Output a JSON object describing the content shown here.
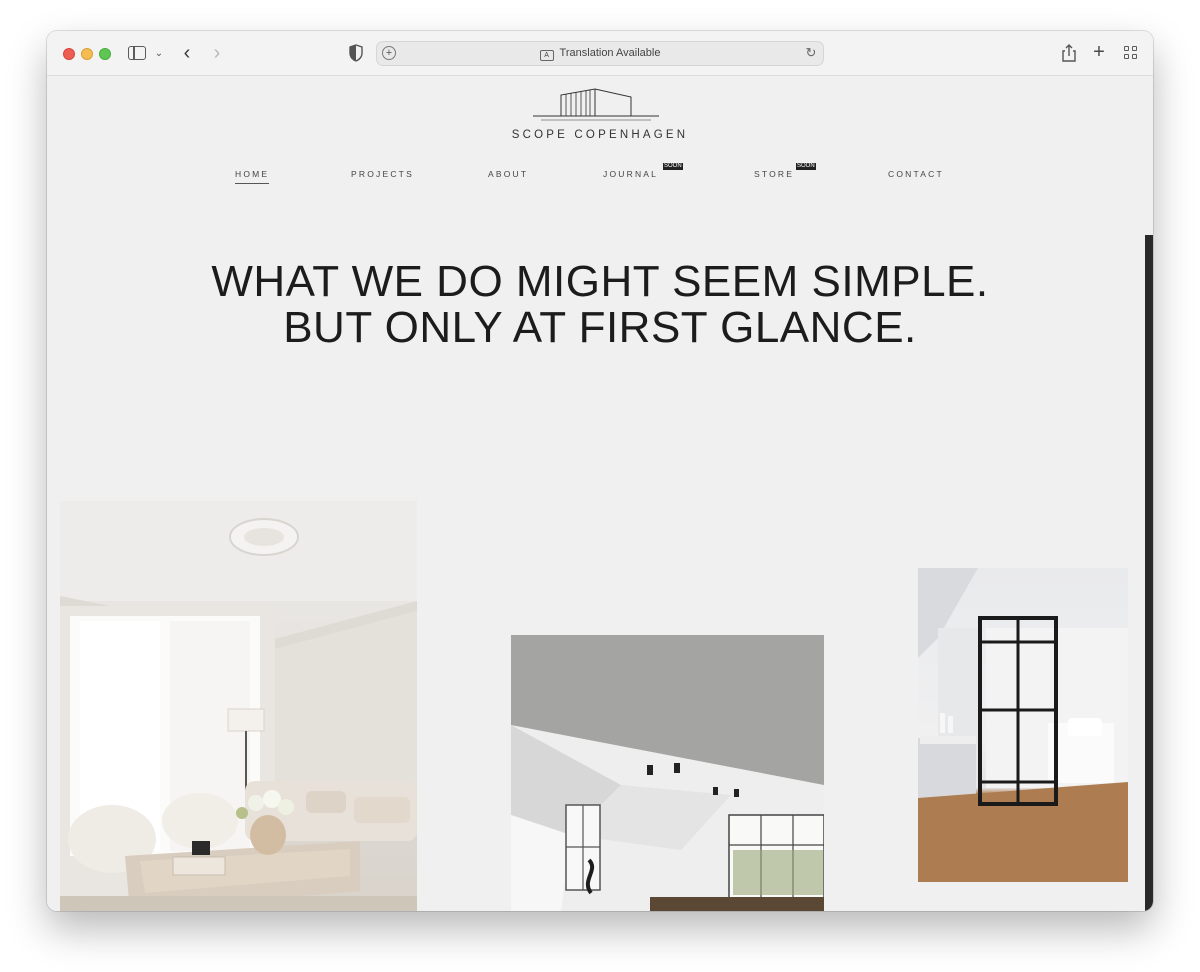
{
  "browser": {
    "url_status": "Translation Available",
    "icons": [
      "sidebar-icon",
      "chevron-down-icon",
      "back-icon",
      "forward-icon",
      "shield-icon",
      "translate-icon",
      "reload-icon",
      "share-icon",
      "plus-icon",
      "tabs-overview-icon"
    ]
  },
  "site": {
    "brand": "SCOPE COPENHAGEN",
    "nav": [
      {
        "label": "HOME",
        "active": true
      },
      {
        "label": "PROJECTS"
      },
      {
        "label": "ABOUT"
      },
      {
        "label": "JOURNAL",
        "badge": "SOON"
      },
      {
        "label": "STORE",
        "badge": "SOON"
      },
      {
        "label": "CONTACT"
      }
    ],
    "headline_line1": "WHAT WE DO MIGHT SEEM SIMPLE.",
    "headline_line2": "BUT ONLY AT FIRST GLANCE."
  },
  "photos": [
    {
      "subject": "living-room-photo"
    },
    {
      "subject": "attic-kitchen-photo"
    },
    {
      "subject": "bedroom-glass-door-photo"
    }
  ],
  "colors": {
    "page_background": "#f0f0f0",
    "text": "#1c1c1c",
    "badge": "#222222"
  }
}
